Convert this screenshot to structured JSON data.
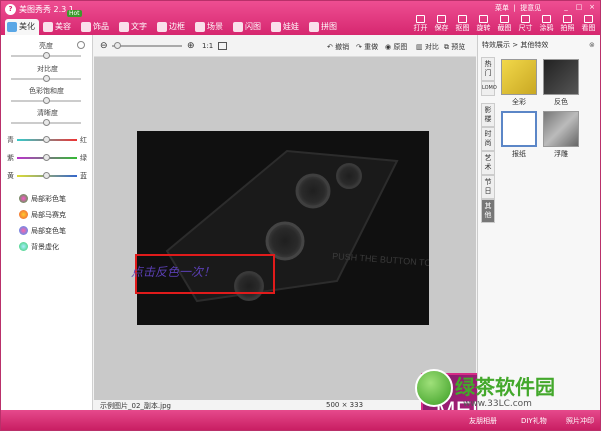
{
  "app": {
    "title": "美图秀秀 2.3.1",
    "hot_badge": "Hot"
  },
  "tabs": [
    {
      "label": "美化"
    },
    {
      "label": "美容"
    },
    {
      "label": "饰品"
    },
    {
      "label": "文字"
    },
    {
      "label": "边框"
    },
    {
      "label": "场景"
    },
    {
      "label": "闪图"
    },
    {
      "label": "娃娃"
    },
    {
      "label": "拼图"
    }
  ],
  "topmenu": {
    "menu": "菜单",
    "feedback": "提意见"
  },
  "actions": [
    {
      "label": "打开"
    },
    {
      "label": "保存"
    },
    {
      "label": "抠图"
    },
    {
      "label": "旋转"
    },
    {
      "label": "截图"
    },
    {
      "label": "尺寸"
    },
    {
      "label": "涂鸦"
    },
    {
      "label": "拍照"
    },
    {
      "label": "看图"
    }
  ],
  "left": {
    "sliders": [
      {
        "label": "亮度",
        "value": 0.5
      },
      {
        "label": "对比度",
        "value": 0.5
      },
      {
        "label": "色彩饱和度",
        "value": 0.5
      },
      {
        "label": "清晰度",
        "value": 0.5
      }
    ],
    "color_sliders": [
      {
        "left": "青",
        "right": "红",
        "value": 0.5
      },
      {
        "left": "紫",
        "right": "绿",
        "value": 0.5
      },
      {
        "left": "黄",
        "right": "蓝",
        "value": 0.5
      }
    ],
    "brushes": [
      {
        "label": "局部彩色笔",
        "icon": "color-brush-icon"
      },
      {
        "label": "局部马赛克",
        "icon": "mosaic-brush-icon"
      },
      {
        "label": "局部变色笔",
        "icon": "recolor-brush-icon"
      },
      {
        "label": "背景虚化",
        "icon": "blur-background-icon"
      }
    ]
  },
  "toolbar": {
    "zoom_label": "1:1",
    "undo": "撤销",
    "redo": "重做",
    "original": "原图",
    "compare": "对比",
    "preview": "预览"
  },
  "canvas": {
    "photo_text": "PUSH THE BUTTON TO",
    "note": "点击反色一次！",
    "mei": "MEI"
  },
  "status": {
    "filename": "示例图片_02_副本.jpg",
    "dimensions": "500 × 333"
  },
  "right": {
    "header": "特效展示 > 其他特效",
    "vtabs": [
      {
        "label": "热门"
      },
      {
        "label": "LOMO"
      },
      {
        "label": "影楼"
      },
      {
        "label": "时尚"
      },
      {
        "label": "艺术"
      },
      {
        "label": "节日"
      },
      {
        "label": "其他"
      }
    ],
    "effects": [
      {
        "label": "全彩"
      },
      {
        "label": "反色"
      },
      {
        "label": "报纸"
      },
      {
        "label": "浮雕"
      }
    ]
  },
  "bottom": {
    "link1": "友朋相册",
    "link2": "DIY礼物",
    "link3": "照片冲印"
  },
  "watermark": {
    "text": "绿茶软件园",
    "url": "www.33LC.com"
  }
}
